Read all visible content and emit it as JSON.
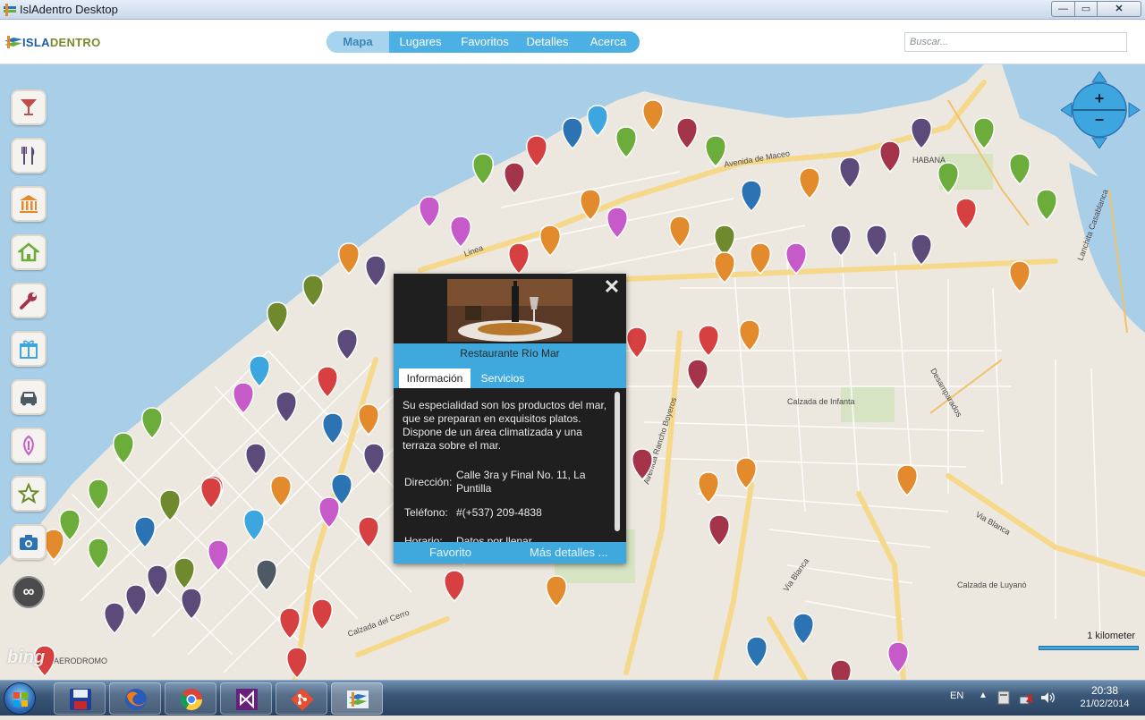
{
  "window": {
    "title": "IslAdentro Desktop",
    "close_glyph": "✕",
    "min_glyph": "—",
    "max_glyph": "▭"
  },
  "header": {
    "logo_text_1": "ISLA",
    "logo_text_2": "DENTRO",
    "tabs": [
      {
        "label": "Mapa",
        "active": true
      },
      {
        "label": "Lugares",
        "active": false
      },
      {
        "label": "Favoritos",
        "active": false
      },
      {
        "label": "Detalles",
        "active": false
      },
      {
        "label": "Acerca",
        "active": false
      }
    ],
    "search_placeholder": "Buscar..."
  },
  "sidebar": {
    "categories": [
      {
        "icon": "cocktail-icon",
        "color": "#c74a4a"
      },
      {
        "icon": "fork-knife-icon",
        "color": "#5b4a7a"
      },
      {
        "icon": "museum-icon",
        "color": "#e38b2c"
      },
      {
        "icon": "house-icon",
        "color": "#6cac3a"
      },
      {
        "icon": "wrench-icon",
        "color": "#a3344a"
      },
      {
        "icon": "gift-icon",
        "color": "#3ea6df"
      },
      {
        "icon": "car-icon",
        "color": "#4d5a66"
      },
      {
        "icon": "pin-icon",
        "color": "#c65ac8"
      },
      {
        "icon": "star-icon",
        "color": "#6f8a2c"
      },
      {
        "icon": "camera-icon",
        "color": "#2b73b2"
      }
    ],
    "toggle_glyph": "∞"
  },
  "map": {
    "scale_label": "1 kilometer",
    "attribution": "bing",
    "colors": {
      "water": "#a9cfe8",
      "land": "#ece8df",
      "road_major": "#f6d88a",
      "road_minor": "#ffffff",
      "green": "#d6e4c3"
    }
  },
  "popup": {
    "close_glyph": "✕",
    "name": "Restaurante Río Mar",
    "tabs": [
      {
        "label": "Información",
        "active": true
      },
      {
        "label": "Servicios",
        "active": false
      }
    ],
    "description": "Su especialidad son los productos del mar, que se preparan en exquisitos platos. Dispone de un área climatizada y una terraza sobre el mar.",
    "fields": [
      {
        "key": "Dirección:",
        "value": "Calle 3ra y Final No. 11, La Puntilla"
      },
      {
        "key": "Teléfono:",
        "value": "#(+537) 209-4838"
      },
      {
        "key": "Horario:",
        "value": "Datos por llenar."
      }
    ],
    "favorite_label": "Favorito",
    "more_label": "Más detalles ..."
  },
  "taskbar": {
    "apps": [
      "save-icon",
      "firefox-icon",
      "chrome-icon",
      "visual-studio-icon",
      "git-icon",
      "isladentro-icon"
    ],
    "language": "EN",
    "time": "20:38",
    "date": "21/02/2014"
  }
}
